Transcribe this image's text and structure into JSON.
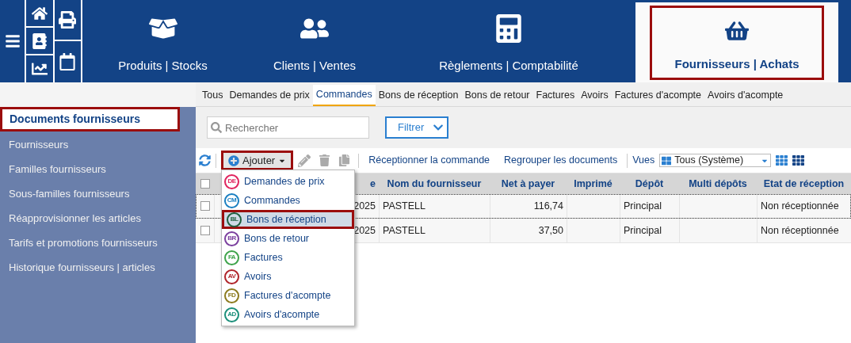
{
  "modules": [
    {
      "label": "Produits | Stocks",
      "selected": false
    },
    {
      "label": "Clients | Ventes",
      "selected": false
    },
    {
      "label": "Règlements | Comptabilité",
      "selected": false
    },
    {
      "label": "Fournisseurs | Achats",
      "selected": true
    }
  ],
  "sidebar": {
    "items": [
      {
        "label": "Documents fournisseurs",
        "selected": true
      },
      {
        "label": "Fournisseurs",
        "selected": false
      },
      {
        "label": "Familles fournisseurs",
        "selected": false
      },
      {
        "label": "Sous-familles fournisseurs",
        "selected": false
      },
      {
        "label": "Réapprovisionner les articles",
        "selected": false
      },
      {
        "label": "Tarifs et promotions fournisseurs",
        "selected": false
      },
      {
        "label": "Historique fournisseurs | articles",
        "selected": false
      }
    ]
  },
  "tabs": [
    {
      "label": "Tous",
      "selected": false
    },
    {
      "label": "Demandes de prix",
      "selected": false
    },
    {
      "label": "Commandes",
      "selected": true
    },
    {
      "label": "Bons de réception",
      "selected": false
    },
    {
      "label": "Bons de retour",
      "selected": false
    },
    {
      "label": "Factures",
      "selected": false
    },
    {
      "label": "Avoirs",
      "selected": false
    },
    {
      "label": "Factures d'acompte",
      "selected": false
    },
    {
      "label": "Avoirs d'acompte",
      "selected": false
    }
  ],
  "search": {
    "placeholder": "Rechercher"
  },
  "filter_button": "Filtrer",
  "toolbar": {
    "add_button": "Ajouter",
    "actions": [
      "Réceptionner la commande",
      "Regrouper les documents"
    ],
    "views_label": "Vues",
    "views_value": "Tous (Système)"
  },
  "add_menu": [
    {
      "code": "DE",
      "label": "Demandes de prix",
      "color": "#e0245e",
      "selected": false
    },
    {
      "code": "CM",
      "label": "Commandes",
      "color": "#1a7fc1",
      "selected": false
    },
    {
      "code": "BL",
      "label": "Bons de réception",
      "color": "#1f5f3f",
      "selected": true
    },
    {
      "code": "BR",
      "label": "Bons de retour",
      "color": "#7b3f9e",
      "selected": false
    },
    {
      "code": "FA",
      "label": "Factures",
      "color": "#3ea34a",
      "selected": false
    },
    {
      "code": "AV",
      "label": "Avoirs",
      "color": "#b0242a",
      "selected": false
    },
    {
      "code": "FD",
      "label": "Factures d'acompte",
      "color": "#8c7a1e",
      "selected": false
    },
    {
      "code": "AD",
      "label": "Avoirs d'acompte",
      "color": "#1a8f7a",
      "selected": false
    }
  ],
  "table": {
    "header_checked": false,
    "columns": [
      "e",
      "Nom du fournisseur",
      "Net à payer",
      "Imprimé",
      "Dépôt",
      "Multi dépôts",
      "Etat de réception"
    ],
    "rows": [
      {
        "checked": false,
        "focused": true,
        "cells": [
          "2025",
          "PASTELL",
          "116,74",
          "",
          "Principal",
          "",
          "Non réceptionnée"
        ]
      },
      {
        "checked": false,
        "focused": false,
        "cells": [
          "2025",
          "PASTELL",
          "37,50",
          "",
          "Principal",
          "",
          "Non réceptionnée"
        ]
      }
    ]
  }
}
